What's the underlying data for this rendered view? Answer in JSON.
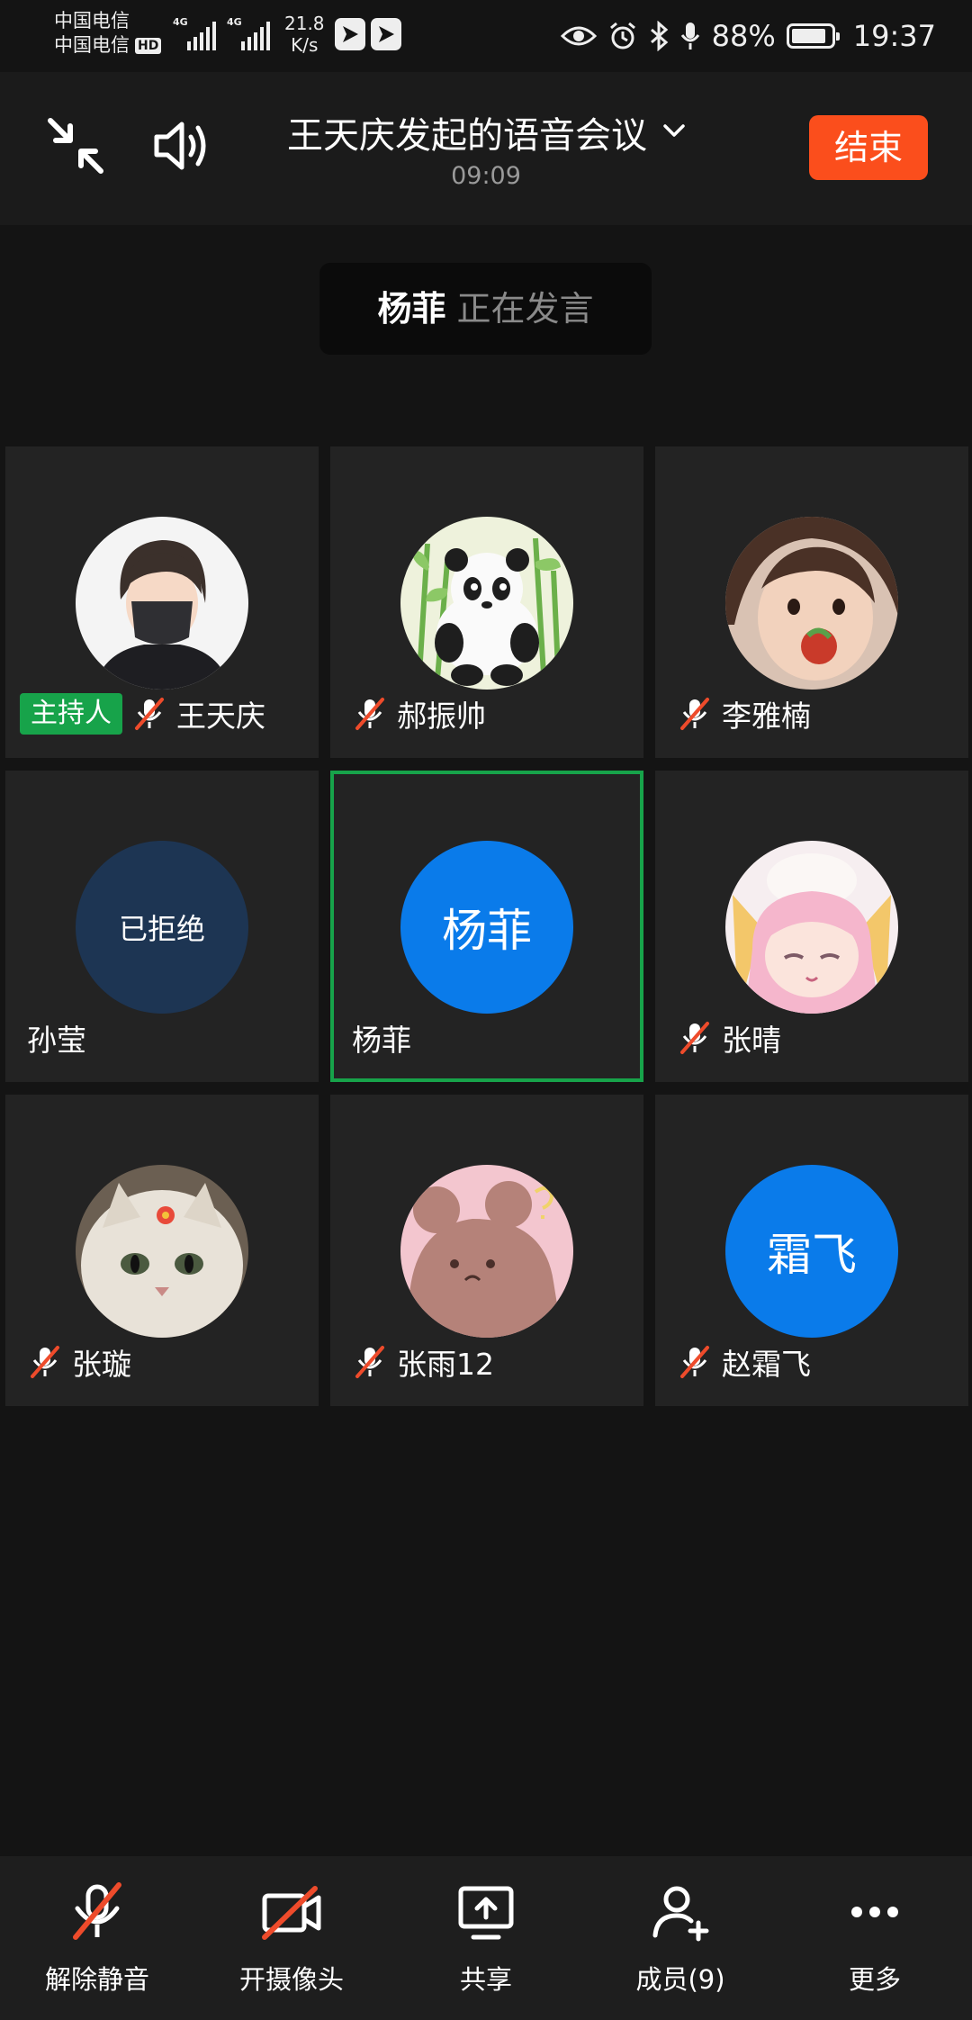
{
  "status_bar": {
    "carrier_1": "中国电信",
    "carrier_2": "中国电信",
    "hd": "HD",
    "network_1": "4G",
    "network_2": "4G",
    "speed_value": "21.8",
    "speed_unit": "K/s",
    "battery": "88%",
    "time": "19:37"
  },
  "meeting": {
    "title": "王天庆发起的语音会议",
    "timer": "09:09",
    "end_label": "结束"
  },
  "speaking": {
    "name": "杨菲",
    "status": "正在发言"
  },
  "participants": [
    {
      "name": "王天庆",
      "host_badge": "主持人",
      "muted": true,
      "avatar": "photo-man-mask"
    },
    {
      "name": "郝振帅",
      "muted": true,
      "avatar": "photo-panda"
    },
    {
      "name": "李雅楠",
      "muted": true,
      "avatar": "photo-child"
    },
    {
      "name": "孙莹",
      "muted": false,
      "avatar": "declined",
      "avatar_text": "已拒绝"
    },
    {
      "name": "杨菲",
      "muted": false,
      "avatar": "initials",
      "avatar_text": "杨菲",
      "active_speaker": true
    },
    {
      "name": "张晴",
      "muted": true,
      "avatar": "photo-anime-girl"
    },
    {
      "name": "张璇",
      "muted": true,
      "avatar": "photo-cat"
    },
    {
      "name": "张雨12",
      "muted": true,
      "avatar": "photo-bear"
    },
    {
      "name": "赵霜飞",
      "muted": true,
      "avatar": "initials",
      "avatar_text": "霜飞"
    }
  ],
  "toolbar": {
    "unmute": "解除静音",
    "camera": "开摄像头",
    "share": "共享",
    "members": "成员(9)",
    "more": "更多"
  },
  "colors": {
    "accent_end": "#fb4e1c",
    "host_badge": "#17a34a",
    "active_border": "#17a34a",
    "initials_avatar": "#0a7bea",
    "mute_slash": "#ee4b2b"
  }
}
